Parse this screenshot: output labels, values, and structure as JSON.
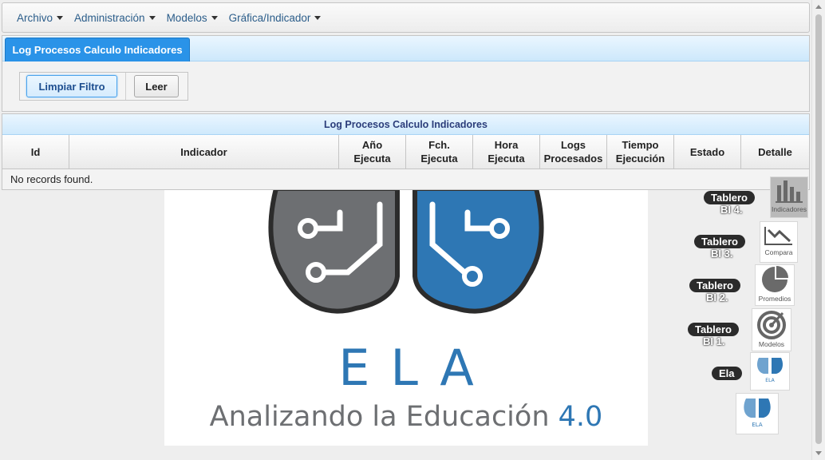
{
  "menu": [
    {
      "label": "Archivo"
    },
    {
      "label": "Administración"
    },
    {
      "label": "Modelos"
    },
    {
      "label": "Gráfica/Indicador"
    }
  ],
  "panel": {
    "tab_label": "Log Procesos Calculo Indicadores",
    "buttons": {
      "filter": "Limpiar Filtro",
      "read": "Leer"
    }
  },
  "grid": {
    "caption": "Log Procesos Calculo Indicadores",
    "columns": [
      {
        "line1": "Id",
        "line2": ""
      },
      {
        "line1": "Indicador",
        "line2": ""
      },
      {
        "line1": "Año",
        "line2": "Ejecuta"
      },
      {
        "line1": "Fch.",
        "line2": "Ejecuta"
      },
      {
        "line1": "Hora",
        "line2": "Ejecuta"
      },
      {
        "line1": "Logs",
        "line2": "Procesados"
      },
      {
        "line1": "Tiempo",
        "line2": "Ejecución"
      },
      {
        "line1": "Estado",
        "line2": ""
      },
      {
        "line1": "Detalle",
        "line2": ""
      }
    ],
    "empty_message": "No records found."
  },
  "logo": {
    "name": "ELA",
    "tagline": "Analizando la Educación",
    "version": "4.0"
  },
  "dock": [
    {
      "title": "Tablero",
      "sub": "BI 4.",
      "icon_label": "Indicadores",
      "icon": "bar-chart-icon"
    },
    {
      "title": "Tablero",
      "sub": "BI 3.",
      "icon_label": "Compara",
      "icon": "trend-line-icon"
    },
    {
      "title": "Tablero",
      "sub": "BI 2.",
      "icon_label": "Promedios",
      "icon": "pie-chart-icon"
    },
    {
      "title": "Tablero",
      "sub": "BI 1.",
      "icon_label": "Modelos",
      "icon": "target-icon"
    },
    {
      "title": "Ela",
      "sub": "",
      "icon_label": "",
      "icon": "ela-logo-icon"
    }
  ],
  "colors": {
    "accent": "#2a93e8",
    "brand_blue": "#2e77b4",
    "brand_gray": "#6d6f72"
  }
}
